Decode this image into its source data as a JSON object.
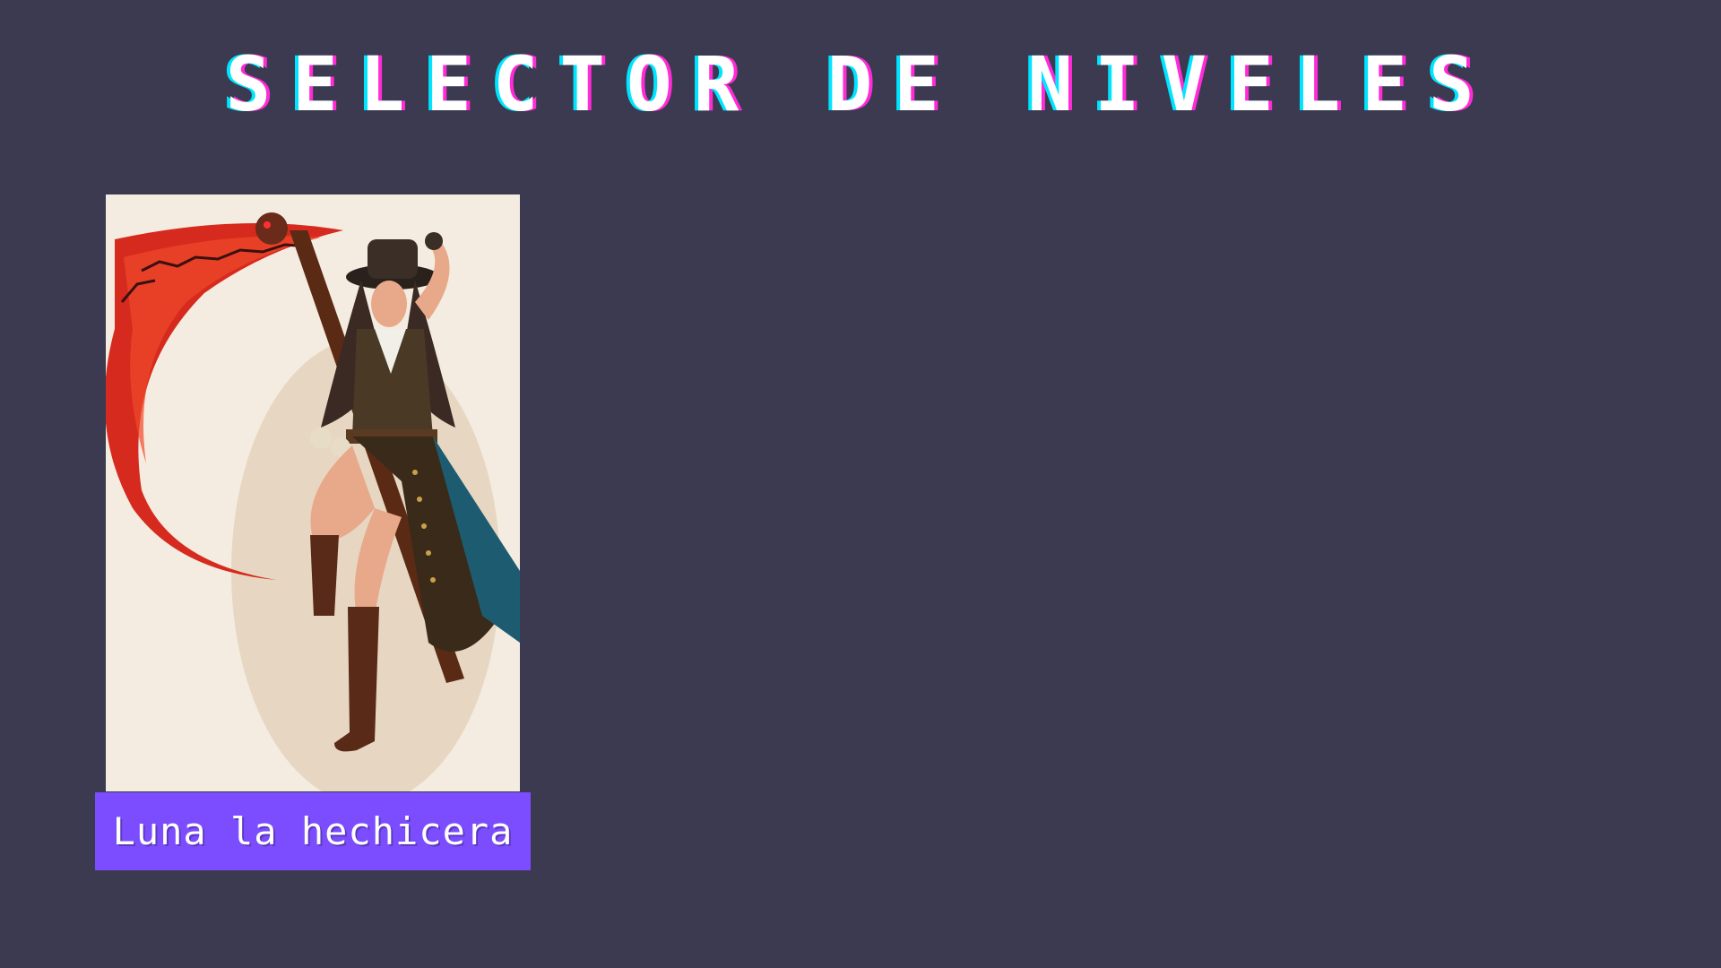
{
  "header": {
    "title": "SELECTOR DE NIVELES"
  },
  "levels": [
    {
      "name": "Luna la hechicera",
      "portrait_icon": "scythe-witch-character-portrait"
    }
  ],
  "colors": {
    "background": "#3b3a50",
    "title_text": "#ffffff",
    "title_glitch_cyan": "#00e5ff",
    "title_glitch_magenta": "#ff2bd6",
    "card_label_bg": "#7c4dff",
    "portrait_bg": "#f4ece0"
  }
}
